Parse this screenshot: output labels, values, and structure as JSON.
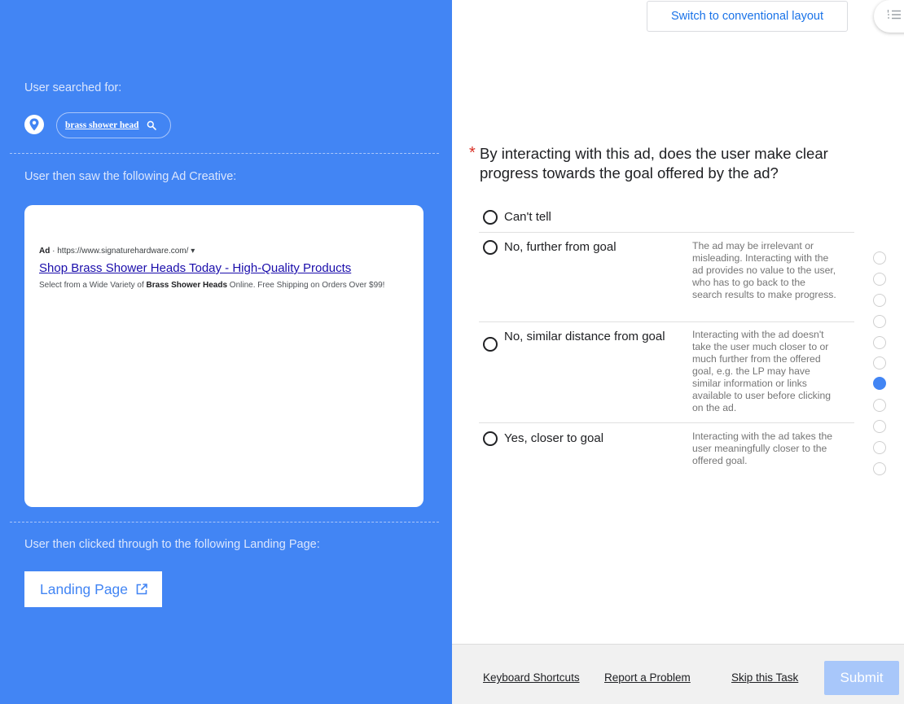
{
  "left": {
    "searched_label": "User searched for:",
    "query": "brass shower head",
    "saw_label": "User then saw the following Ad Creative:",
    "clicked_label": "User then clicked through to the following Landing Page:",
    "landing_button": "Landing Page"
  },
  "ad": {
    "badge": "Ad",
    "url": "https://www.signaturehardware.com/",
    "title": "Shop Brass Shower Heads Today - High-Quality Products",
    "desc_before": "Select from a Wide Variety of ",
    "desc_bold": "Brass Shower Heads",
    "desc_after": " Online. Free Shipping on Orders Over $99!"
  },
  "header": {
    "switch_layout": "Switch to conventional layout"
  },
  "question": {
    "required_marker": "*",
    "text": "By interacting with this ad, does the user make clear progress towards the goal offered by the ad?",
    "options": [
      {
        "label": "Can't tell",
        "desc": ""
      },
      {
        "label": "No, further from goal",
        "desc": "The ad may be irrelevant or misleading. Interacting with the ad provides no value to the user, who has to go back to the search results to make progress."
      },
      {
        "label": "No, similar distance from goal",
        "desc": "Interacting with the ad doesn't take the user much closer to or much further from the offered goal, e.g. the LP may have similar information or links available to user before clicking on the ad."
      },
      {
        "label": "Yes, closer to goal",
        "desc": "Interacting with the ad takes the user meaningfully closer to the offered goal."
      }
    ]
  },
  "progress": {
    "total_steps": 11,
    "active_step": 7
  },
  "footer": {
    "keyboard_shortcuts": "Keyboard Shortcuts",
    "report_problem": "Report a Problem",
    "skip_task": "Skip this Task",
    "submit": "Submit"
  },
  "colors": {
    "panel_blue": "#4285f4",
    "link_blue": "#1a0dab",
    "required_red": "#d93025",
    "submit_disabled": "#a8c7fa"
  }
}
